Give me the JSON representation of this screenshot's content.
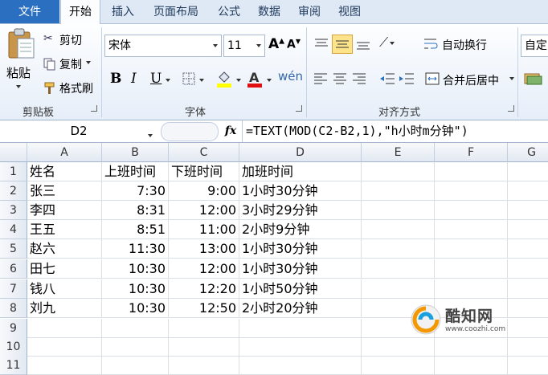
{
  "tabs": [
    "文件",
    "开始",
    "插入",
    "页面布局",
    "公式",
    "数据",
    "审阅",
    "视图"
  ],
  "ribbon": {
    "clipboard": {
      "paste": "粘贴",
      "cut": "剪切",
      "copy": "复制",
      "format_painter": "格式刷",
      "label": "剪贴板"
    },
    "font": {
      "name": "宋体",
      "size": "11",
      "label": "字体"
    },
    "alignment": {
      "wrap_text": "自动换行",
      "merge_center": "合并后居中",
      "label": "对齐方式"
    },
    "number": {
      "format": "自定"
    }
  },
  "formula_bar": {
    "name_box": "D2",
    "fx": "fx",
    "formula": "=TEXT(MOD(C2-B2,1),\"h小时m分钟\")"
  },
  "columns": [
    "A",
    "B",
    "C",
    "D",
    "E",
    "F",
    "G"
  ],
  "rows": [
    [
      "姓名",
      "上班时间",
      "下班时间",
      "加班时间"
    ],
    [
      "张三",
      "7:30",
      "9:00",
      "1小时30分钟"
    ],
    [
      "李四",
      "8:31",
      "12:00",
      "3小时29分钟"
    ],
    [
      "王五",
      "8:51",
      "11:00",
      "2小时9分钟"
    ],
    [
      "赵六",
      "11:30",
      "13:00",
      "1小时30分钟"
    ],
    [
      "田七",
      "10:30",
      "12:00",
      "1小时30分钟"
    ],
    [
      "钱八",
      "10:30",
      "12:20",
      "1小时50分钟"
    ],
    [
      "刘九",
      "10:30",
      "12:50",
      "2小时20分钟"
    ],
    [
      "",
      "",
      "",
      ""
    ],
    [
      "",
      "",
      "",
      ""
    ],
    [
      "",
      "",
      "",
      ""
    ]
  ],
  "row_numbers": [
    "1",
    "2",
    "3",
    "4",
    "5",
    "6",
    "7",
    "8",
    "9",
    "10",
    "11"
  ],
  "watermark": {
    "name": "酷知网",
    "url": "www.coozhi.com"
  },
  "colors": {
    "file_tab": "#2a6fc0",
    "ribbon_bg": "#e6eef9",
    "header_bg": "#e3e9f2"
  }
}
